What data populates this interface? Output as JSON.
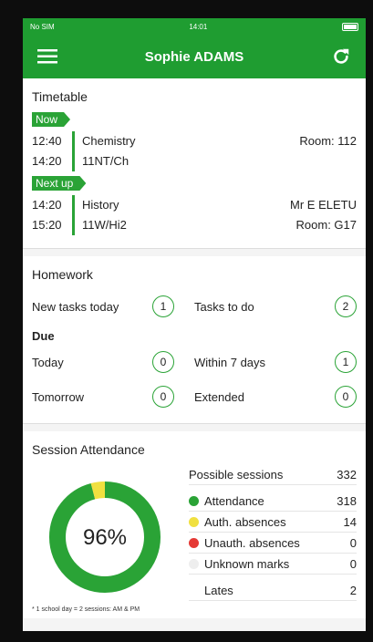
{
  "status": {
    "carrier": "No SIM",
    "time": "14:01"
  },
  "header": {
    "title": "Sophie ADAMS"
  },
  "colors": {
    "brand": "#1f9d31",
    "attendance": "#2aa336",
    "auth_absence": "#f0e040",
    "unauth_absence": "#e53935",
    "unknown": "#eeeeee"
  },
  "timetable": {
    "title": "Timetable",
    "now": {
      "tag": "Now",
      "start": "12:40",
      "end": "14:20",
      "subject": "Chemistry",
      "group": "11NT/Ch",
      "teacher": "",
      "room": "Room: 112"
    },
    "next": {
      "tag": "Next up",
      "start": "14:20",
      "end": "15:20",
      "subject": "History",
      "group": "11W/Hi2",
      "teacher": "Mr E ELETU",
      "room": "Room: G17"
    }
  },
  "homework": {
    "title": "Homework",
    "new_tasks_label": "New tasks today",
    "new_tasks_count": "1",
    "to_do_label": "Tasks to do",
    "to_do_count": "2",
    "due_label": "Due",
    "today_label": "Today",
    "today_count": "0",
    "within7_label": "Within 7 days",
    "within7_count": "1",
    "tomorrow_label": "Tomorrow",
    "tomorrow_count": "0",
    "extended_label": "Extended",
    "extended_count": "0"
  },
  "attendance": {
    "title": "Session Attendance",
    "percent_label": "96%",
    "possible_label": "Possible sessions",
    "possible_value": "332",
    "attendance_label": "Attendance",
    "attendance_value": "318",
    "auth_label": "Auth. absences",
    "auth_value": "14",
    "unauth_label": "Unauth. absences",
    "unauth_value": "0",
    "unknown_label": "Unknown marks",
    "unknown_value": "0",
    "lates_label": "Lates",
    "lates_value": "2",
    "footnote": "* 1 school day = 2 sessions: AM & PM"
  }
}
